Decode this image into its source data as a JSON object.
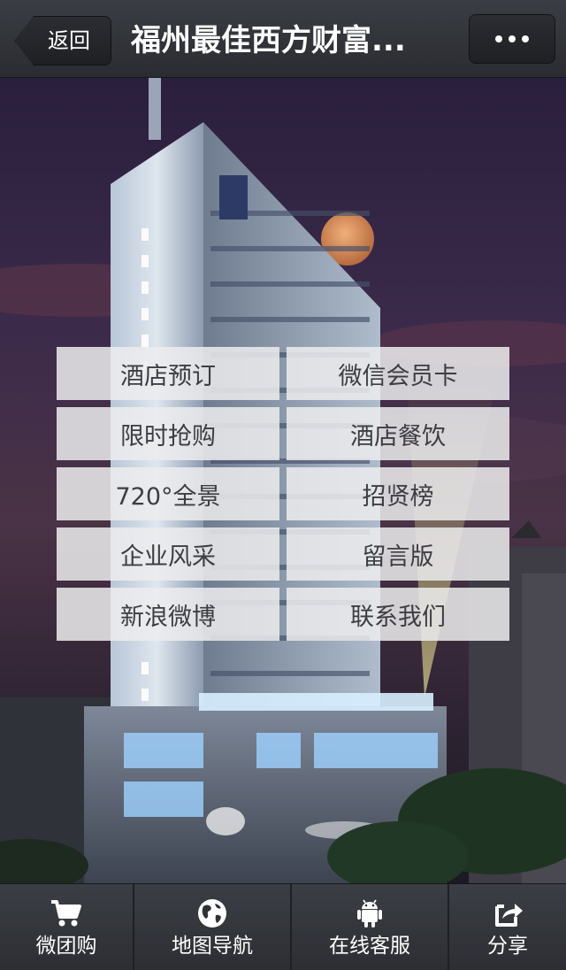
{
  "header": {
    "back_label": "返回",
    "title": "福州最佳西方财富...",
    "more_icon": "more-dots-icon"
  },
  "menu": {
    "items": [
      {
        "label": "酒店预订"
      },
      {
        "label": "微信会员卡"
      },
      {
        "label": "限时抢购"
      },
      {
        "label": "酒店餐饮"
      },
      {
        "label": "720°全景"
      },
      {
        "label": "招贤榜"
      },
      {
        "label": "企业风采"
      },
      {
        "label": "留言版"
      },
      {
        "label": "新浪微博"
      },
      {
        "label": "联系我们"
      }
    ]
  },
  "tabbar": {
    "items": [
      {
        "label": "微团购",
        "icon": "cart-icon"
      },
      {
        "label": "地图导航",
        "icon": "globe-icon"
      },
      {
        "label": "在线客服",
        "icon": "android-icon"
      },
      {
        "label": "分享",
        "icon": "share-icon"
      }
    ]
  },
  "colors": {
    "bar_bg": "#2f3136",
    "menu_tile": "#ececee",
    "menu_text": "#3d3d42",
    "sky": "#3b2a4a",
    "moon": "#d88a55"
  }
}
